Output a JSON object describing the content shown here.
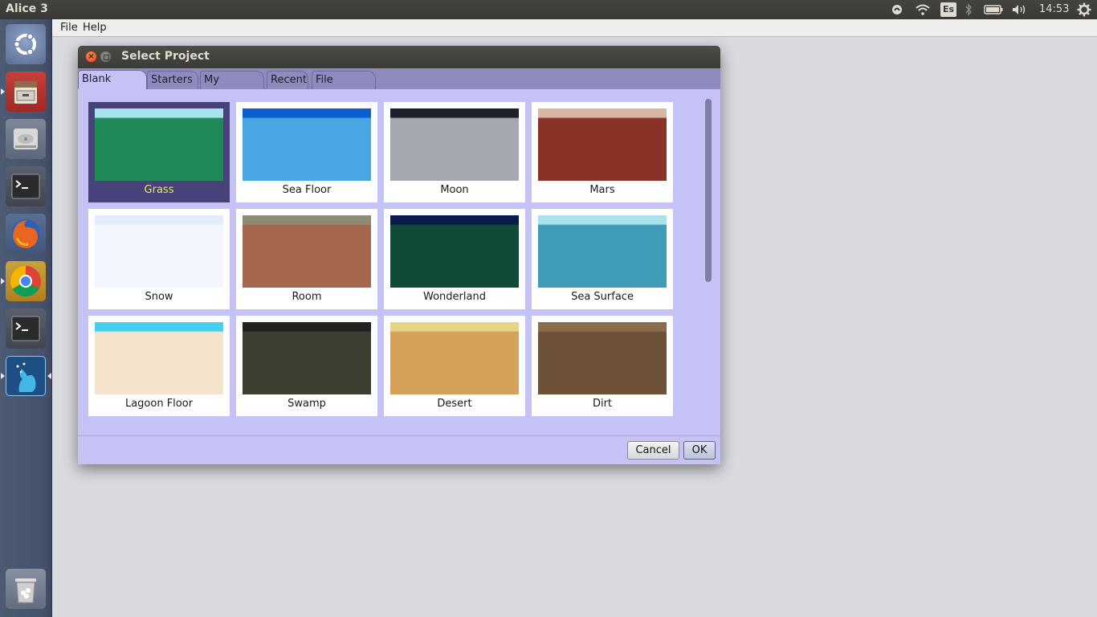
{
  "top_panel": {
    "app_title": "Alice 3",
    "keyboard_layout": "Es",
    "clock": "14:53",
    "icons": [
      "sync-icon",
      "wifi-icon",
      "keyboard-icon",
      "bluetooth-icon",
      "battery-icon",
      "volume-icon",
      "settings-gear-icon"
    ]
  },
  "launcher": {
    "items": [
      "ubuntu-dash",
      "files",
      "disk-drive",
      "terminal",
      "firefox",
      "chrome",
      "terminal",
      "alice",
      "trash"
    ]
  },
  "menubar": {
    "file": "File",
    "help": "Help"
  },
  "dialog": {
    "title": "Select Project",
    "tabs": [
      {
        "label": "Blank Slates",
        "active": true
      },
      {
        "label": "Starters"
      },
      {
        "label": "My Projects"
      },
      {
        "label": "Recent"
      },
      {
        "label": "File System"
      }
    ],
    "tiles": [
      {
        "label": "Grass",
        "selected": true,
        "sky": "#a7e3ef",
        "ground": "#1f8a57"
      },
      {
        "label": "Sea Floor",
        "sky": "#0a5fd0",
        "ground": "#4aa6e3"
      },
      {
        "label": "Moon",
        "sky": "#1d1f2a",
        "ground": "#a6a8b0"
      },
      {
        "label": "Mars",
        "sky": "#d7b5a0",
        "ground": "#8b3226"
      },
      {
        "label": "Snow",
        "sky": "#e2ecfa",
        "ground": "#f3f6fc"
      },
      {
        "label": "Room",
        "sky": "#8d8c73",
        "ground": "#a5684c"
      },
      {
        "label": "Wonderland",
        "sky": "#071a4a",
        "ground": "#0f4a35"
      },
      {
        "label": "Sea Surface",
        "sky": "#a9e2ea",
        "ground": "#3f9cb8"
      },
      {
        "label": "Lagoon Floor",
        "sky": "#44d0ee",
        "ground": "#f4e4cc"
      },
      {
        "label": "Swamp",
        "sky": "#1e2320",
        "ground": "#3c3f30"
      },
      {
        "label": "Desert",
        "sky": "#e6d684",
        "ground": "#d5a159"
      },
      {
        "label": "Dirt",
        "sky": "#8b6d4e",
        "ground": "#6e5238"
      }
    ],
    "buttons": {
      "cancel": "Cancel",
      "ok": "OK"
    }
  }
}
